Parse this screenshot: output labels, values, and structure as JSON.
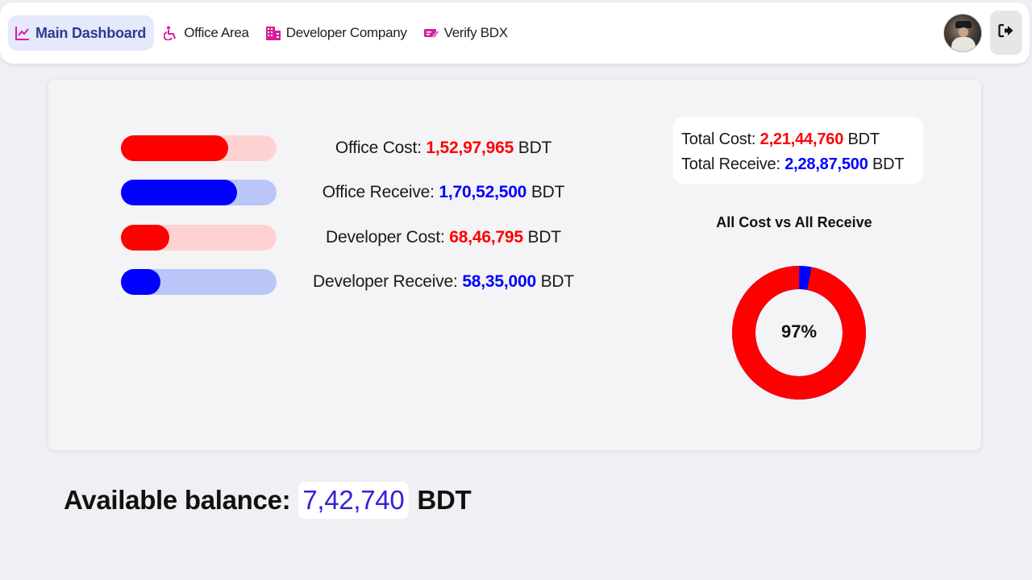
{
  "nav": {
    "items": [
      {
        "label": "Main Dashboard",
        "icon": "chart-line-icon",
        "active": true
      },
      {
        "label": "Office Area",
        "icon": "wheelchair-icon",
        "active": false
      },
      {
        "label": "Developer Company",
        "icon": "building-icon",
        "active": false
      },
      {
        "label": "Verify BDX",
        "icon": "ticket-edit-icon",
        "active": false
      }
    ],
    "avatar": "user-avatar",
    "logout_icon": "logout-icon"
  },
  "stats": [
    {
      "label": "Office Cost:",
      "value": "1,52,97,965",
      "unit": "BDT",
      "color": "#ff0000",
      "track": "#ffd2d2",
      "fraction": 0.69
    },
    {
      "label": "Office Receive:",
      "value": "1,70,52,500",
      "unit": "BDT",
      "color": "#0000ff",
      "track": "#bac6f7",
      "fraction": 0.745
    },
    {
      "label": "Developer Cost:",
      "value": "68,46,795",
      "unit": "BDT",
      "color": "#ff0000",
      "track": "#ffd2d2",
      "fraction": 0.31
    },
    {
      "label": "Developer Receive:",
      "value": "58,35,000",
      "unit": "BDT",
      "color": "#0000ff",
      "track": "#bac6f7",
      "fraction": 0.255
    }
  ],
  "totals": {
    "cost_label": "Total Cost:",
    "cost_value": "2,21,44,760",
    "receive_label": "Total Receive:",
    "receive_value": "2,28,87,500",
    "unit": "BDT"
  },
  "donut": {
    "title": "All Cost vs All Receive",
    "percent_text": "97%",
    "cost_share": 0.97,
    "cost_color": "#ff0000",
    "remainder_color": "#0000ff"
  },
  "balance": {
    "label": "Available balance:",
    "value": "7,42,740",
    "unit": "BDT"
  }
}
